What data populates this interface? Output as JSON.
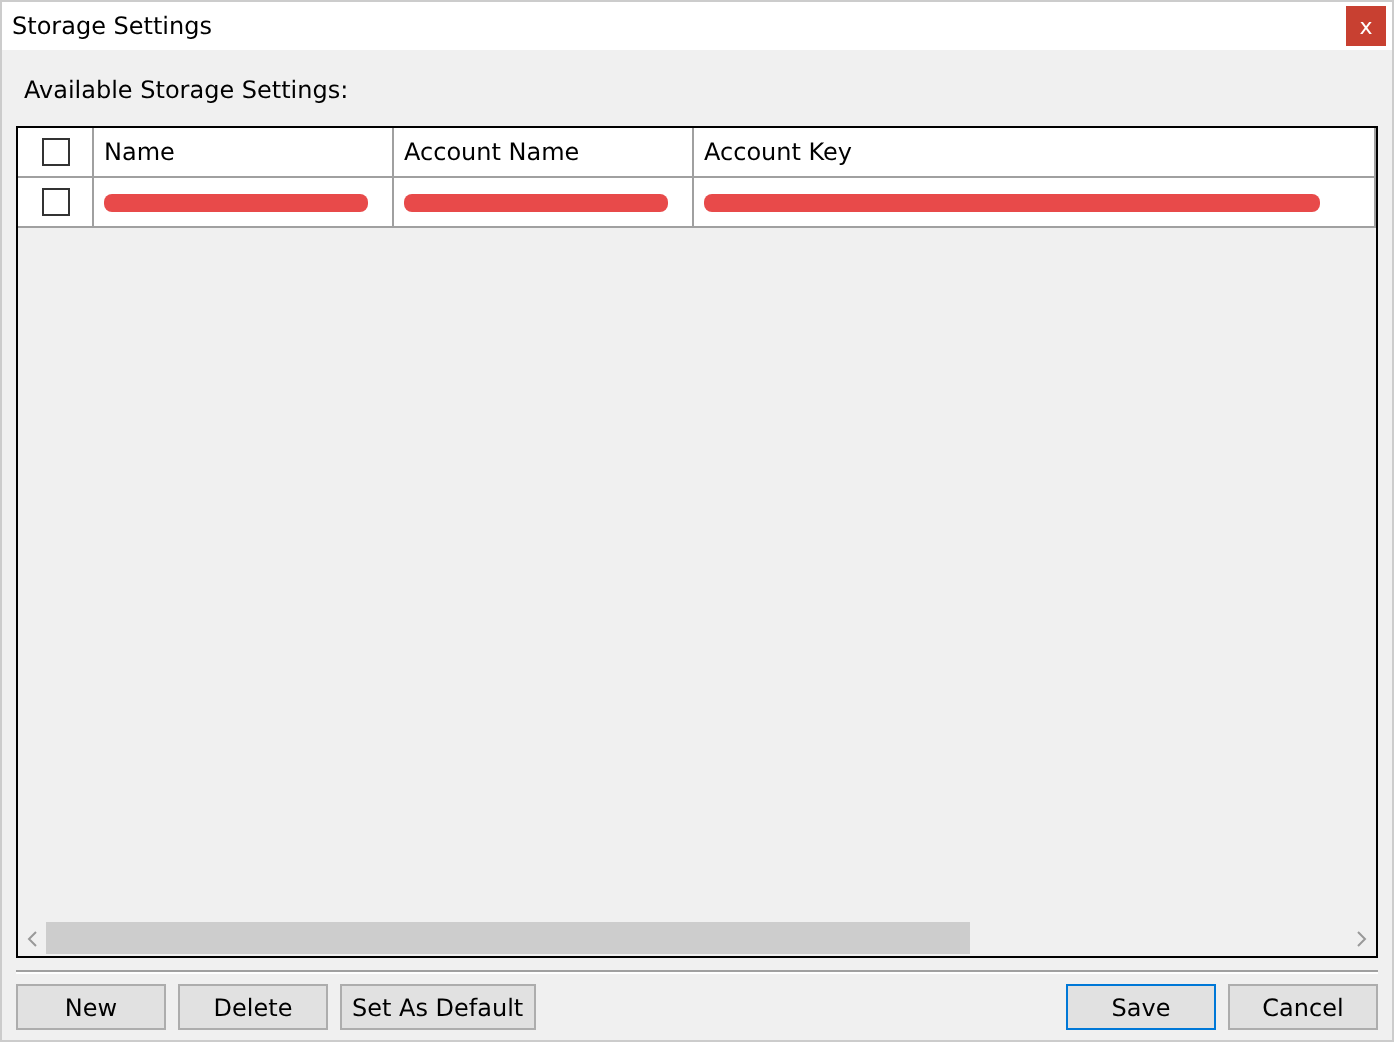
{
  "window": {
    "title": "Storage Settings",
    "close": "x"
  },
  "label": "Available Storage Settings:",
  "table": {
    "select_all": {
      "checked": false
    },
    "columns": [
      "Name",
      "Account Name",
      "Account Key"
    ],
    "rows": [
      {
        "checked": false,
        "cells": [
          {
            "kind": "redacted"
          },
          {
            "kind": "redacted"
          },
          {
            "kind": "redacted"
          }
        ]
      }
    ]
  },
  "buttons_left": [
    "New",
    "Delete",
    "Set As Default"
  ],
  "buttons_right": [
    {
      "label": "Save",
      "focused": true
    },
    {
      "label": "Cancel",
      "focused": false
    }
  ]
}
